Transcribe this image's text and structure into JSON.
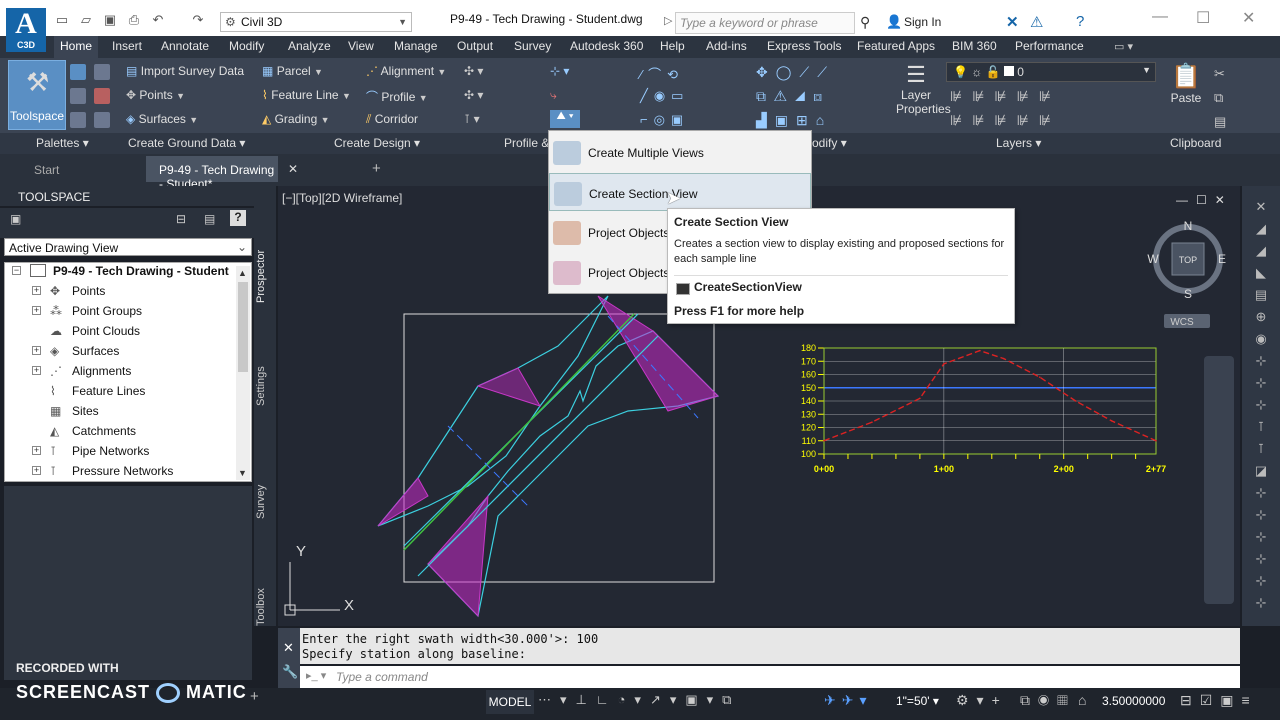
{
  "app": {
    "logo_letter": "A",
    "logo_sub": "C3D",
    "workspace": "Civil 3D",
    "doc_title": "P9-49 - Tech Drawing - Student.dwg",
    "search_placeholder": "Type a keyword or phrase",
    "sign_in": "Sign In"
  },
  "menu": {
    "tabs": [
      "Home",
      "Insert",
      "Annotate",
      "Modify",
      "Analyze",
      "View",
      "Manage",
      "Output",
      "Survey",
      "Autodesk 360",
      "Help",
      "Add-ins",
      "Express Tools",
      "Featured Apps",
      "BIM 360",
      "Performance"
    ]
  },
  "ribbon": {
    "toolspace": "Toolspace",
    "import_survey": "Import Survey Data",
    "points": "Points",
    "surfaces": "Surfaces",
    "parcel": "Parcel",
    "feature_line": "Feature Line",
    "grading": "Grading",
    "alignment": "Alignment",
    "profile": "Profile",
    "corridor": "Corridor",
    "layer_properties_1": "Layer",
    "layer_properties_2": "Properties",
    "layer_current": "0",
    "paste": "Paste",
    "panels": {
      "palettes": "Palettes",
      "create_ground": "Create Ground Data",
      "create_design": "Create Design",
      "profile_sec": "Profile &",
      "modify": "odify",
      "layers": "Layers",
      "clipboard": "Clipboard"
    }
  },
  "doc_tabs": {
    "start": "Start",
    "drawing": "P9-49 - Tech Drawing - Student*"
  },
  "toolspace": {
    "header": "TOOLSPACE",
    "view_select": "Active Drawing View",
    "root": "P9-49 - Tech Drawing - Student",
    "items": [
      "Points",
      "Point Groups",
      "Point Clouds",
      "Surfaces",
      "Alignments",
      "Feature Lines",
      "Sites",
      "Catchments",
      "Pipe Networks",
      "Pressure Networks"
    ],
    "side_tabs": [
      "Prospector",
      "Settings",
      "Survey",
      "Toolbox"
    ]
  },
  "viewport": {
    "label": "[−][Top][2D Wireframe]",
    "compass": {
      "n": "N",
      "s": "S",
      "e": "E",
      "w": "W",
      "top": "TOP"
    },
    "wcs": "WCS",
    "ucs_x": "X",
    "ucs_y": "Y"
  },
  "dropdown": {
    "items": [
      "Create Multiple Views",
      "Create Section View",
      "Project Objects",
      "Project Objects"
    ]
  },
  "tooltip": {
    "title": "Create Section View",
    "description": "Creates a section view to display existing and proposed sections for each sample line",
    "command": "CreateSectionView",
    "help": "Press F1 for more help"
  },
  "chart_data": {
    "type": "line",
    "title": "",
    "xlabel": "",
    "ylabel": "",
    "x_tick_labels": [
      "0+00",
      "1+00",
      "2+00",
      "2+77"
    ],
    "y_tick_labels": [
      "100",
      "110",
      "120",
      "130",
      "140",
      "150",
      "160",
      "170",
      "180"
    ],
    "xlim": [
      0,
      277
    ],
    "ylim": [
      100,
      180
    ],
    "series": [
      {
        "values_x": [
          0,
          40,
          80,
          100,
          130,
          150,
          180,
          210,
          240,
          277
        ],
        "values_y": [
          110,
          124,
          142,
          168,
          178,
          172,
          158,
          140,
          125,
          110
        ]
      }
    ],
    "colors": {
      "grid": "#ffffff",
      "frame": "#9acd32",
      "labels": "#ffff00",
      "profile": "#dd2222",
      "datum": "#3c78ff"
    }
  },
  "command": {
    "history": [
      "Enter the right swath width<30.000'>: 100",
      "Specify station along baseline:"
    ],
    "placeholder": "Type a command"
  },
  "status": {
    "model": "MODEL",
    "scale": "1\"=50'",
    "coord": "3.50000000",
    "recorded_with": "RECORDED WITH",
    "screencast": "SCREENCAST",
    "matic": "MATIC"
  }
}
